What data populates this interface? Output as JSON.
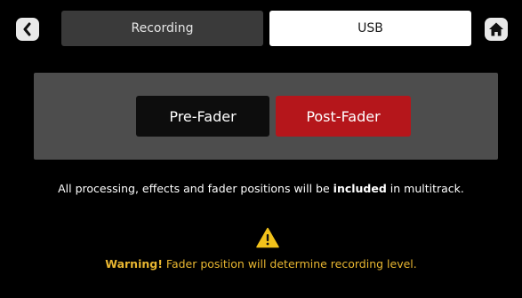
{
  "header": {
    "back_icon": "chevron-left-icon",
    "home_icon": "home-icon",
    "tabs": [
      {
        "label": "Recording",
        "selected": false
      },
      {
        "label": "USB",
        "selected": true
      }
    ]
  },
  "panel": {
    "options": [
      {
        "label": "Pre-Fader",
        "selected": false
      },
      {
        "label": "Post-Fader",
        "selected": true
      }
    ]
  },
  "info": {
    "before": "All processing, effects and fader positions will be ",
    "emphasis": "included",
    "after": " in multitrack."
  },
  "warning": {
    "icon": "warning-triangle-icon",
    "label": "Warning!",
    "text": " Fader position will determine recording level."
  },
  "colors": {
    "background": "#000000",
    "panel": "#4d4d4d",
    "selected_tab": "#ffffff",
    "unselected_tab": "#3a3a3a",
    "accent_red": "#b5161b",
    "warning_yellow": "#e8b631"
  }
}
